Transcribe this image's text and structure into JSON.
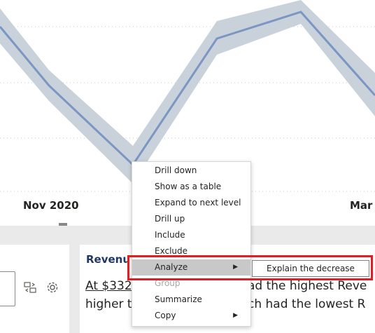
{
  "chart": {
    "x_labels": [
      "Nov 2020",
      "Mar"
    ]
  },
  "narrative": {
    "title": "Revenu",
    "line1": "At $332",
    "line1_tail": "ad the highest Reve",
    "line2": "higher t",
    "line2_tail": "ch had the lowest R"
  },
  "context_menu": {
    "items": [
      {
        "label": "Drill down"
      },
      {
        "label": "Show as a table"
      },
      {
        "label": "Expand to next level"
      },
      {
        "label": "Drill up"
      },
      {
        "label": "Include"
      },
      {
        "label": "Exclude"
      },
      {
        "label": "Analyze"
      },
      {
        "label": "Group"
      },
      {
        "label": "Summarize"
      },
      {
        "label": "Copy"
      }
    ],
    "submenu_item": "Explain the decrease"
  },
  "colors": {
    "line": "#7b96c2",
    "band": "#c9d2da",
    "highlight": "#e01e26"
  },
  "icons": [
    "swap-icon",
    "gear-icon",
    "chevron-right-icon"
  ]
}
